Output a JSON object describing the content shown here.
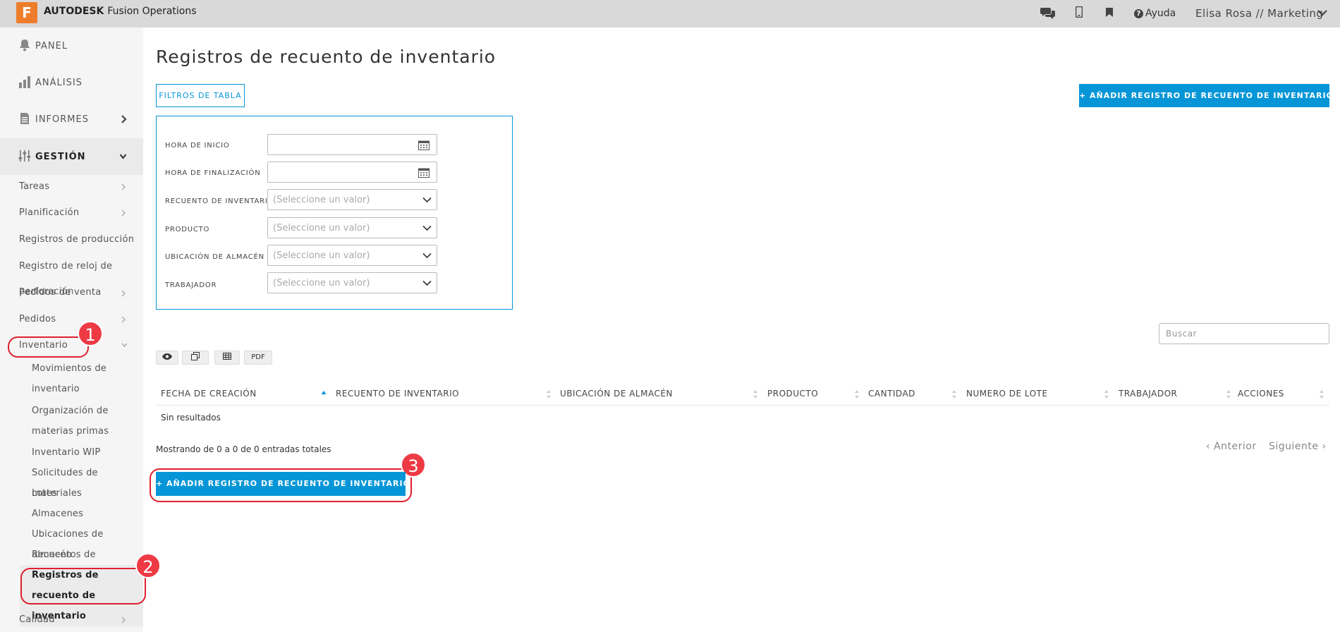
{
  "topbar": {
    "logo_letter": "F",
    "brand_strong": "AUTODESK",
    "brand_product": "Fusion Operations",
    "help_label": "Ayuda",
    "user_label": "Elisa Rosa // Marketing"
  },
  "sidebar": {
    "panel": "PANEL",
    "analisis": "ANÁLISIS",
    "informes": "INFORMES",
    "gestion": "GESTIÓN",
    "sub": {
      "tareas": "Tareas",
      "planificacion": "Planificación",
      "registros_produccion": "Registros de producción",
      "registro_reloj": "Registro de reloj de",
      "registro_reloj_overlap": "perforación",
      "pedidos_venta": "Pedidos de venta",
      "pedidos": "Pedidos",
      "inventario": "Inventario",
      "calidad": "Calidad"
    },
    "inventory_items": [
      "Movimientos de inventario",
      "Organización de materias primas",
      "Inventario WIP",
      "Solicitudes de materiales",
      "Lotes",
      "Almacenes",
      "Ubicaciones de almacén",
      "Recuentos de inventario",
      "Registros de recuento de inventario"
    ]
  },
  "annotations": {
    "one": "1",
    "two": "2",
    "three": "3"
  },
  "main": {
    "title": "Registros de recuento de inventario",
    "filters_button": "FILTROS DE TABLA",
    "add_button": "+ AÑADIR REGISTRO DE RECUENTO DE INVENTARIO",
    "add_button_bottom": "+ AÑADIR REGISTRO DE RECUENTO DE INVENTARIO",
    "filters": {
      "start_label": "HORA DE INICIO",
      "end_label": "HORA DE FINALIZACIÓN",
      "count_label": "RECUENTO DE INVENTARIO",
      "product_label": "PRODUCTO",
      "location_label": "UBICACIÓN DE ALMACÉN",
      "worker_label": "TRABAJADOR",
      "placeholder": "(Seleccione un valor)"
    },
    "search_placeholder": "Buscar",
    "toolbar": {
      "pdf": "PDF"
    },
    "columns": [
      "FECHA DE CREACIÓN",
      "RECUENTO DE INVENTARIO",
      "UBICACIÓN DE ALMACÉN",
      "PRODUCTO",
      "CANTIDAD",
      "NUMERO DE LOTE",
      "TRABAJADOR",
      "ACCIONES"
    ],
    "no_results": "Sin resultados",
    "showing": "Mostrando de 0 a 0 de 0 entradas totales",
    "prev": "‹ Anterior",
    "next": "Siguiente ›"
  }
}
